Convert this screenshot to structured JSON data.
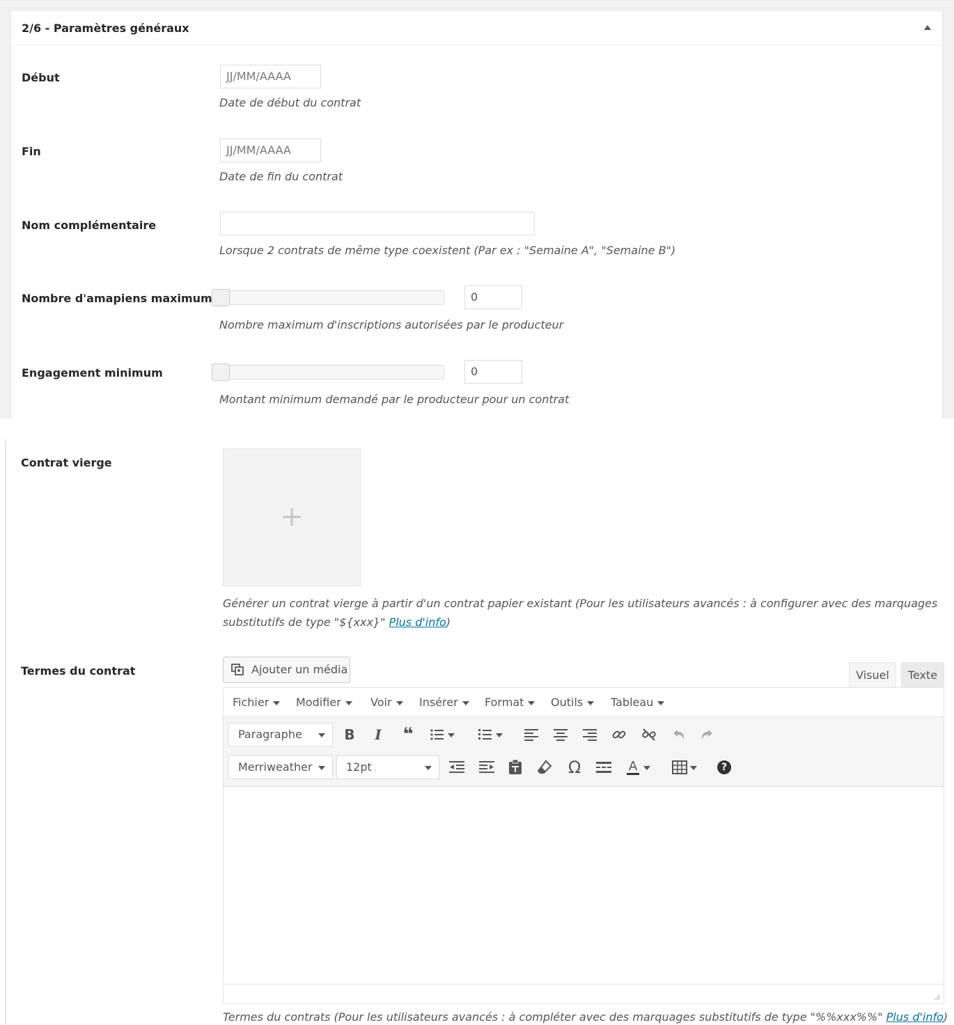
{
  "section": {
    "title": "2/6 - Paramètres généraux"
  },
  "fields": {
    "debut": {
      "label": "Début",
      "placeholder": "JJ/MM/AAAA",
      "description": "Date de début du contrat"
    },
    "fin": {
      "label": "Fin",
      "placeholder": "JJ/MM/AAAA",
      "description": "Date de fin du contrat"
    },
    "nom_complementaire": {
      "label": "Nom complémentaire",
      "value": "",
      "description": "Lorsque 2 contrats de même type coexistent (Par ex : \"Semaine A\", \"Semaine B\")"
    },
    "nombre_amapiens": {
      "label": "Nombre d'amapiens maximum",
      "value": "0",
      "slider_fraction": 0,
      "description": "Nombre maximum d'inscriptions autorisées par le producteur"
    },
    "engagement_minimum": {
      "label": "Engagement minimum",
      "value": "0",
      "slider_fraction": 0,
      "description": "Montant minimum demandé par le producteur pour un contrat"
    },
    "contrat_vierge": {
      "label": "Contrat vierge",
      "add_symbol": "+",
      "description_line1": "Générer un contrat vierge à partir d'un contrat papier existant (Pour les utilisateurs avancés : à configurer avec des marquages",
      "description_line2": "substitutifs de type \"${xxx}\" ",
      "link": "Plus d'info",
      "after_link": ")"
    },
    "termes": {
      "label": "Termes du contrat",
      "description": "Termes du contrats (Pour les utilisateurs avancés : à compléter avec des marquages substitutifs de type \"%%xxx%%\" ",
      "link": "Plus d'info",
      "after_link": ")"
    }
  },
  "editor": {
    "add_media_label": "Ajouter un média",
    "tabs": {
      "visual": "Visuel",
      "text": "Texte"
    },
    "menu": [
      "Fichier",
      "Modifier",
      "Voir",
      "Insérer",
      "Format",
      "Outils",
      "Tableau"
    ],
    "block_format": "Paragraphe",
    "font_family": "Merriweather",
    "font_size": "12pt",
    "icons": {
      "bold": "B",
      "italic": "I",
      "blockquote": "❝",
      "omega": "Ω",
      "text_color": "A",
      "help": "?"
    }
  }
}
